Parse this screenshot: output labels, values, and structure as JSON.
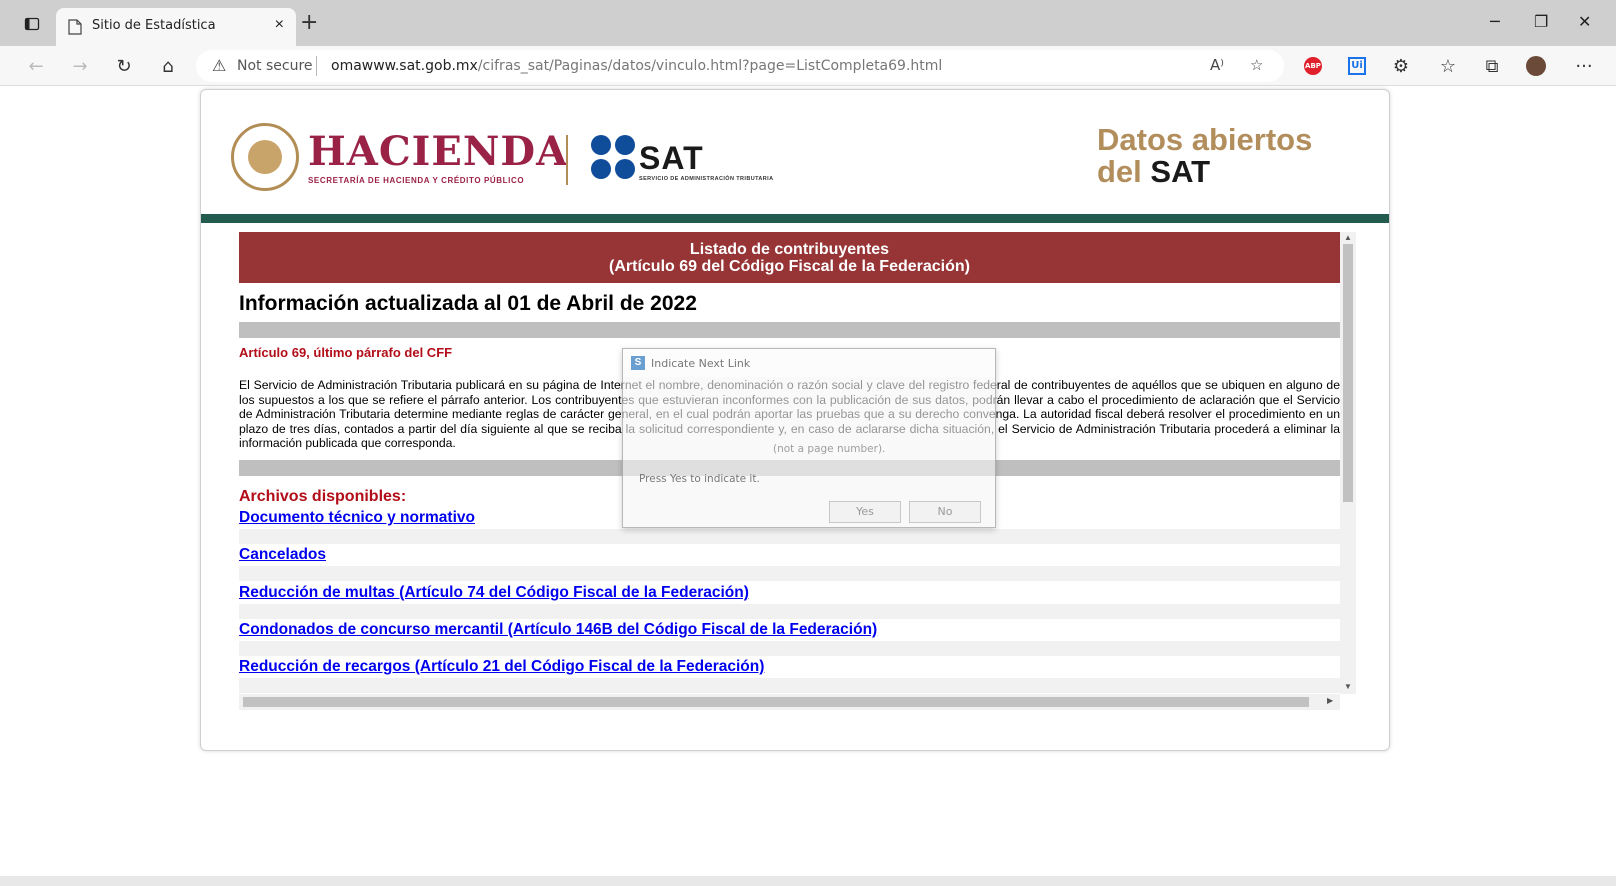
{
  "browser": {
    "tab_title": "Sitio de Estadística",
    "tab_close": "×",
    "new_tab": "+",
    "security_label": "Not secure",
    "url_domain": "omawww.sat.gob.mx",
    "url_path": "/cifras_sat/Paginas/datos/vinculo.html?page=ListCompleta69.html",
    "read_aloud": "A⁾",
    "more": "···",
    "adblock_label": "ABP",
    "ext_label": "Ui"
  },
  "header": {
    "hacienda": "HACIENDA",
    "hacienda_sub": "SECRETARÍA DE HACIENDA Y CRÉDITO PÚBLICO",
    "sat": "SAT",
    "sat_sub": "SERVICIO DE ADMINISTRACIÓN TRIBUTARIA",
    "datos_line1": "Datos abiertos",
    "datos_line2_prefix": "del ",
    "datos_line2_bold": "SAT",
    "brand_color": "#9b2247",
    "gold_color": "#b38e5d",
    "green_color": "#235b4e"
  },
  "content": {
    "banner_line1": "Listado de contribuyentes",
    "banner_line2": "(Artículo 69 del Código Fiscal de la Federación)",
    "updated": "Información actualizada al 01 de Abril de 2022",
    "article_title": "Artículo 69, último párrafo del CFF",
    "article_text": "El Servicio de Administración Tributaria publicará en su página de Internet el nombre, denominación o razón social y clave del registro federal de contribuyentes de aquéllos que se ubiquen en alguno de los supuestos a los que se refiere el párrafo anterior. Los contribuyentes que estuvieran inconformes con la publicación de sus datos, podrán llevar a cabo el procedimiento de aclaración que el Servicio de Administración Tributaria determine mediante reglas de carácter general, en el cual podrán aportar las pruebas que a su derecho convenga. La autoridad fiscal deberá resolver el procedimiento en un plazo de tres días, contados a partir del día siguiente al que se reciba la solicitud correspondiente y, en caso de aclararse dicha situación, el Servicio de Administración Tributaria procederá a eliminar la información publicada que corresponda.",
    "archivos_title": "Archivos disponibles:",
    "links": [
      "Documento técnico y normativo",
      "Cancelados",
      "Reducción de multas (Artículo 74 del Código Fiscal de la Federación)",
      "Condonados de concurso mercantil (Artículo 146B del Código Fiscal de la Federación)",
      "Reducción de recargos (Artículo 21 del Código Fiscal de la Federación)"
    ]
  },
  "dialog": {
    "title": "Indicate Next Link",
    "icon": "S",
    "hint": "(not a page number).",
    "press": "Press Yes to indicate it.",
    "yes": "Yes",
    "no": "No"
  }
}
